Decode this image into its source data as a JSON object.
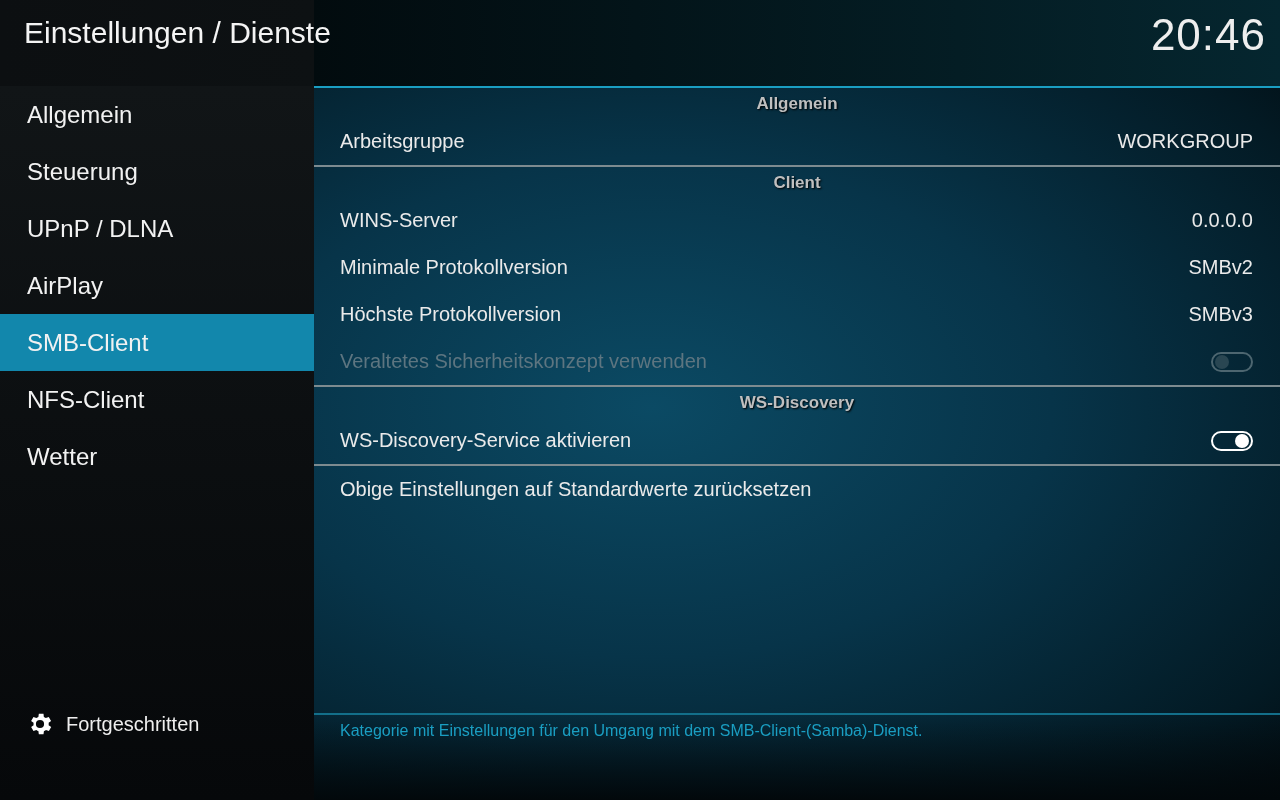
{
  "header": {
    "title": "Einstellungen / Dienste",
    "clock": "20:46"
  },
  "sidebar": {
    "items": [
      {
        "label": "Allgemein",
        "selected": false
      },
      {
        "label": "Steuerung",
        "selected": false
      },
      {
        "label": "UPnP / DLNA",
        "selected": false
      },
      {
        "label": "AirPlay",
        "selected": false
      },
      {
        "label": "SMB-Client",
        "selected": true
      },
      {
        "label": "NFS-Client",
        "selected": false
      },
      {
        "label": "Wetter",
        "selected": false
      }
    ],
    "level_button": {
      "label": "Fortgeschritten"
    }
  },
  "sections": [
    {
      "title": "Allgemein",
      "rows": [
        {
          "kind": "value",
          "label": "Arbeitsgruppe",
          "value": "WORKGROUP",
          "disabled": false
        }
      ]
    },
    {
      "title": "Client",
      "rows": [
        {
          "kind": "value",
          "label": "WINS-Server",
          "value": "0.0.0.0",
          "disabled": false
        },
        {
          "kind": "value",
          "label": "Minimale Protokollversion",
          "value": "SMBv2",
          "disabled": false
        },
        {
          "kind": "value",
          "label": "Höchste Protokollversion",
          "value": "SMBv3",
          "disabled": false
        },
        {
          "kind": "toggle",
          "label": "Veraltetes Sicherheitskonzept verwenden",
          "on": false,
          "disabled": true
        }
      ]
    },
    {
      "title": "WS-Discovery",
      "rows": [
        {
          "kind": "toggle",
          "label": "WS-Discovery-Service aktivieren",
          "on": true,
          "disabled": false
        }
      ]
    },
    {
      "rows": [
        {
          "kind": "action",
          "label": "Obige Einstellungen auf Standardwerte zurücksetzen",
          "disabled": false
        }
      ]
    }
  ],
  "description": "Kategorie mit Einstellungen für den Umgang mit dem SMB-Client-(Samba)-Dienst."
}
